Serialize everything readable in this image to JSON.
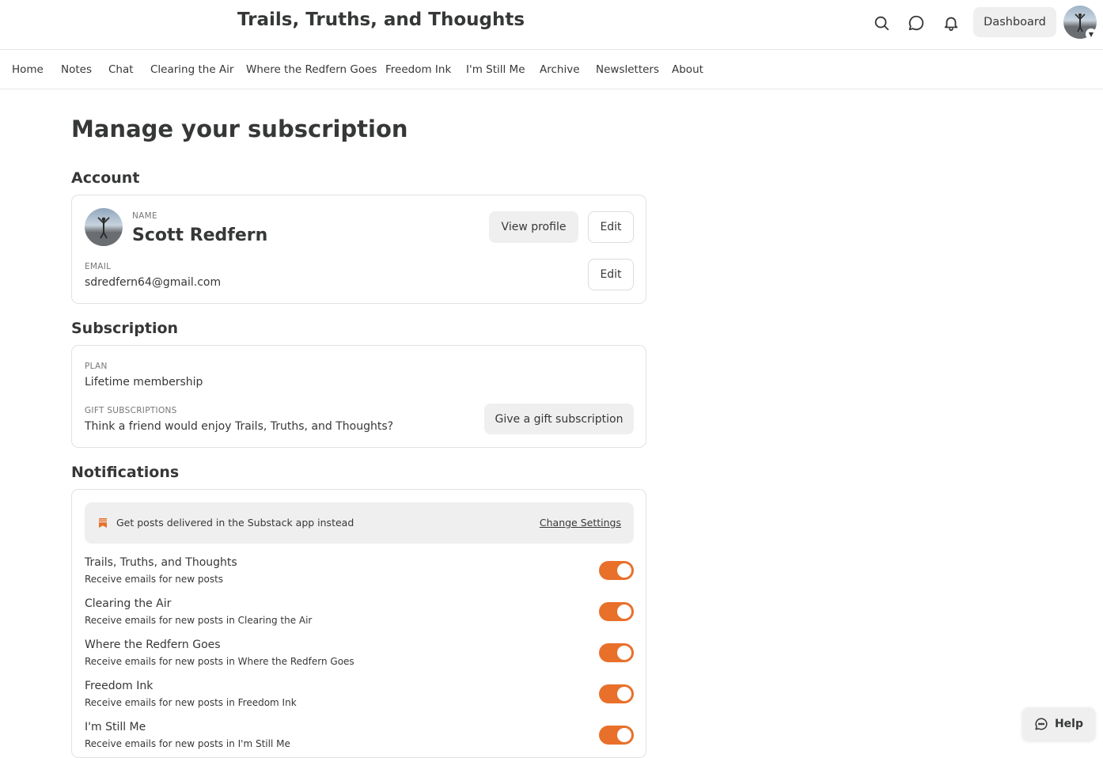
{
  "header": {
    "publication_title": "Trails, Truths, and Thoughts",
    "dashboard_label": "Dashboard",
    "icons": [
      "search-icon",
      "chat-bubble-icon",
      "bell-icon",
      "avatar",
      "chevron-down-icon"
    ]
  },
  "nav": {
    "items": [
      {
        "label": "Home"
      },
      {
        "label": "Notes"
      },
      {
        "label": "Chat"
      },
      {
        "label": "Clearing the Air"
      },
      {
        "label": "Where the Redfern Goes"
      },
      {
        "label": "Freedom Ink"
      },
      {
        "label": "I'm Still Me"
      },
      {
        "label": "Archive"
      },
      {
        "label": "Newsletters"
      },
      {
        "label": "About"
      }
    ]
  },
  "page": {
    "title": "Manage your subscription"
  },
  "account": {
    "heading": "Account",
    "name_label": "NAME",
    "name": "Scott Redfern",
    "view_profile_label": "View profile",
    "edit_label": "Edit",
    "email_label": "EMAIL",
    "email": "sdredfern64@gmail.com",
    "email_edit_label": "Edit"
  },
  "subscription": {
    "heading": "Subscription",
    "plan_label": "PLAN",
    "plan": "Lifetime membership",
    "gift_label": "GIFT SUBSCRIPTIONS",
    "gift_text": "Think a friend would enjoy Trails, Truths, and Thoughts?",
    "gift_button": "Give a gift subscription"
  },
  "notifications": {
    "heading": "Notifications",
    "banner_text": "Get posts delivered in the Substack app instead",
    "banner_link": "Change Settings",
    "items": [
      {
        "title": "Trails, Truths, and Thoughts",
        "subtitle": "Receive emails for new posts",
        "enabled": true
      },
      {
        "title": "Clearing the Air",
        "subtitle": "Receive emails for new posts in Clearing the Air",
        "enabled": true
      },
      {
        "title": "Where the Redfern Goes",
        "subtitle": "Receive emails for new posts in Where the Redfern Goes",
        "enabled": true
      },
      {
        "title": "Freedom Ink",
        "subtitle": "Receive emails for new posts in Freedom Ink",
        "enabled": true
      },
      {
        "title": "I'm Still Me",
        "subtitle": "Receive emails for new posts in I'm Still Me",
        "enabled": true
      }
    ]
  },
  "help": {
    "label": "Help"
  },
  "colors": {
    "accent": "#e8702a",
    "text": "#363737",
    "button_bg": "#efefef",
    "border": "#e2e2e2"
  }
}
